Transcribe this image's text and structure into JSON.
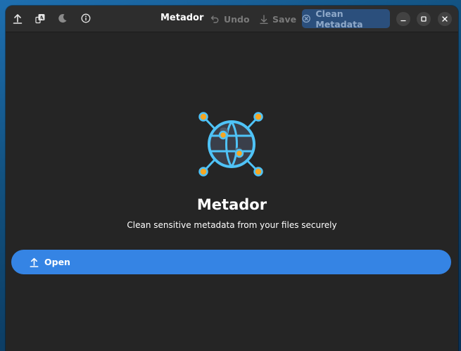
{
  "window": {
    "title": "Metador"
  },
  "header": {
    "icons": [
      "upload-icon",
      "text-format-icon",
      "moon-icon",
      "info-icon"
    ],
    "undo_label": "Undo",
    "save_label": "Save",
    "clean_label": "Clean Metadata"
  },
  "main": {
    "app_name": "Metador",
    "subtitle": "Clean sensitive metadata from your files securely",
    "open_label": "Open"
  },
  "colors": {
    "accent": "#3584e4",
    "window_bg": "#252525",
    "headerbar_bg": "#2d2d2d",
    "clean_button_bg": "#2b4f7c",
    "globe_blue": "#4fc3f7",
    "node_orange": "#f5a623"
  }
}
